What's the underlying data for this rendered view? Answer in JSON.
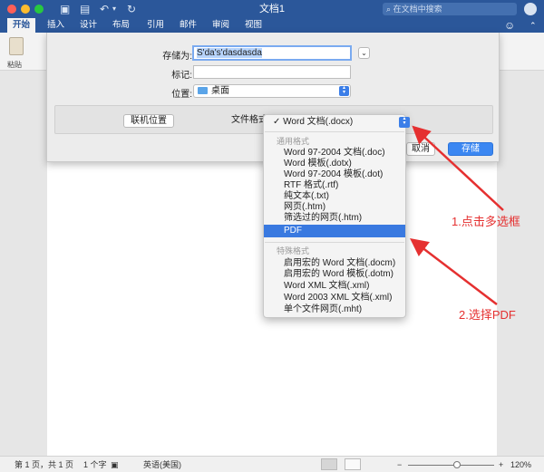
{
  "window": {
    "title": "文档1",
    "search_placeholder": "在文档中搜索"
  },
  "ribbon": {
    "tabs": [
      "开始",
      "插入",
      "设计",
      "布局",
      "引用",
      "邮件",
      "审阅",
      "视图"
    ],
    "active_tab": "开始",
    "paste_label": "粘贴"
  },
  "save_dialog": {
    "save_as_label": "存储为:",
    "save_as_value": "S'da's'dasdasda",
    "tags_label": "标记:",
    "tags_value": "",
    "location_label": "位置:",
    "location_value": "桌面",
    "online_locations_button": "联机位置",
    "format_label": "文件格式",
    "cancel_button": "取消",
    "save_button": "存储"
  },
  "format_menu": {
    "selected": "Word 文档(.docx)",
    "common_header": "通用格式",
    "common_items": [
      "Word 97-2004 文档(.doc)",
      "Word 模板(.dotx)",
      "Word 97-2004 模板(.dot)",
      "RTF 格式(.rtf)",
      "纯文本(.txt)",
      "网页(.htm)",
      "筛选过的网页(.htm)",
      "PDF"
    ],
    "highlighted": "PDF",
    "special_header": "特殊格式",
    "special_items": [
      "启用宏的 Word 文档(.docm)",
      "启用宏的 Word 模板(.dotm)",
      "Word XML 文档(.xml)",
      "Word 2003 XML 文档(.xml)",
      "单个文件网页(.mht)"
    ]
  },
  "annotations": {
    "step1": "1.点击多选框",
    "step2": "2.选择PDF",
    "color": "#e53030"
  },
  "status": {
    "page": "第 1 页，共 1 页",
    "words": "1 个字",
    "language": "英语(美国)",
    "zoom": "120%",
    "zoom_minus": "−",
    "zoom_plus": "+"
  },
  "colors": {
    "accent": "#2b579a",
    "highlight": "#3979e0",
    "primary_button": "#3b87f2"
  }
}
